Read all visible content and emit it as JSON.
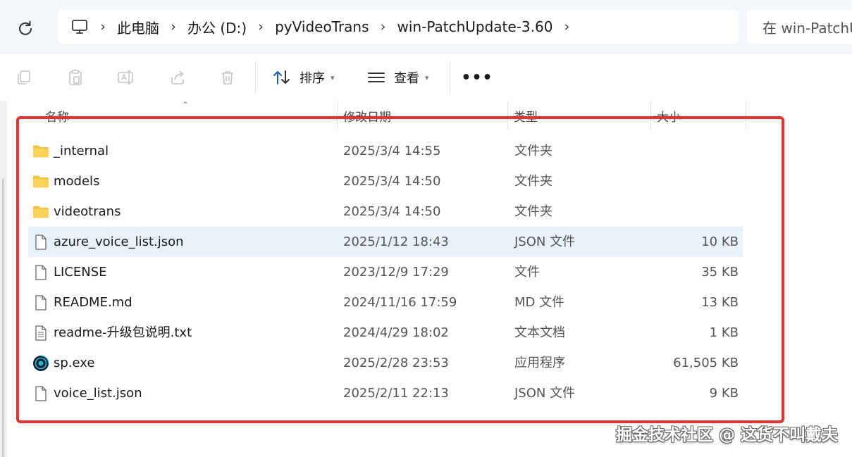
{
  "address_bar": {
    "breadcrumbs": [
      "此电脑",
      "办公 (D:)",
      "pyVideoTrans",
      "win-PatchUpdate-3.60"
    ],
    "search_placeholder": "在 win-PatchU"
  },
  "toolbar": {
    "sort_label": "排序",
    "view_label": "查看",
    "more_label": "•••"
  },
  "columns": {
    "name": "名称",
    "modified": "修改日期",
    "type": "类型",
    "size": "大小"
  },
  "files": [
    {
      "name": "_internal",
      "modified": "2025/3/4 14:55",
      "type": "文件夹",
      "size": "",
      "icon": "folder-icon"
    },
    {
      "name": "models",
      "modified": "2025/3/4 14:50",
      "type": "文件夹",
      "size": "",
      "icon": "folder-icon"
    },
    {
      "name": "videotrans",
      "modified": "2025/3/4 14:50",
      "type": "文件夹",
      "size": "",
      "icon": "folder-icon"
    },
    {
      "name": "azure_voice_list.json",
      "modified": "2025/1/12 18:43",
      "type": "JSON 文件",
      "size": "10 KB",
      "icon": "file-icon",
      "selected": true
    },
    {
      "name": "LICENSE",
      "modified": "2023/12/9 17:29",
      "type": "文件",
      "size": "35 KB",
      "icon": "file-icon"
    },
    {
      "name": "README.md",
      "modified": "2024/11/16 17:59",
      "type": "MD 文件",
      "size": "13 KB",
      "icon": "file-icon"
    },
    {
      "name": "readme-升级包说明.txt",
      "modified": "2024/4/29 18:02",
      "type": "文本文档",
      "size": "1 KB",
      "icon": "text-file-icon"
    },
    {
      "name": "sp.exe",
      "modified": "2025/2/28 23:53",
      "type": "应用程序",
      "size": "61,505 KB",
      "icon": "exe-app-icon"
    },
    {
      "name": "voice_list.json",
      "modified": "2025/2/11 22:13",
      "type": "JSON 文件",
      "size": "9 KB",
      "icon": "file-icon"
    }
  ],
  "watermark": "掘金技术社区 @ 这货不叫戴夫",
  "colors": {
    "highlight_box": "#e8322f",
    "selected_row": "#e9f2fb",
    "address_area_bg": "#f3f6fb",
    "folder": "#f4c342"
  }
}
